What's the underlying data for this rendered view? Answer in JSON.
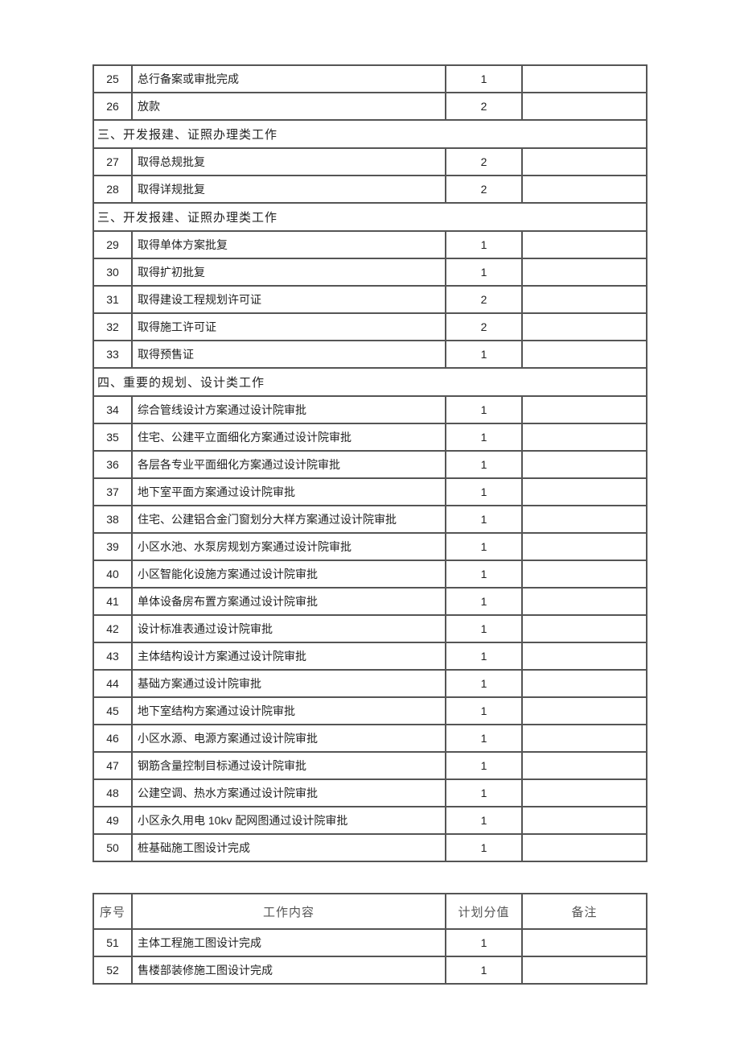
{
  "headers": {
    "idx": "序号",
    "desc": "工作内容",
    "val": "计划分值",
    "note": "备注"
  },
  "sections": [
    {
      "type": "rows",
      "rows": [
        {
          "idx": "25",
          "desc": "总行备案或审批完成",
          "val": "1",
          "note": ""
        },
        {
          "idx": "26",
          "desc": "放款",
          "val": "2",
          "note": ""
        }
      ]
    },
    {
      "type": "section",
      "title": "三、开发报建、证照办理类工作"
    },
    {
      "type": "rows",
      "rows": [
        {
          "idx": "27",
          "desc": "取得总规批复",
          "val": "2",
          "note": ""
        },
        {
          "idx": "28",
          "desc": "取得详规批复",
          "val": "2",
          "note": ""
        }
      ]
    },
    {
      "type": "section",
      "title": "三、开发报建、证照办理类工作"
    },
    {
      "type": "rows",
      "rows": [
        {
          "idx": "29",
          "desc": "取得单体方案批复",
          "val": "1",
          "note": ""
        },
        {
          "idx": "30",
          "desc": "取得扩初批复",
          "val": "1",
          "note": ""
        },
        {
          "idx": "31",
          "desc": "取得建设工程规划许可证",
          "val": "2",
          "note": ""
        },
        {
          "idx": "32",
          "desc": "取得施工许可证",
          "val": "2",
          "note": ""
        },
        {
          "idx": "33",
          "desc": "取得预售证",
          "val": "1",
          "note": ""
        }
      ]
    },
    {
      "type": "section",
      "title": "四、重要的规划、设计类工作"
    },
    {
      "type": "rows",
      "rows": [
        {
          "idx": "34",
          "desc": "综合管线设计方案通过设计院审批",
          "val": "1",
          "note": ""
        },
        {
          "idx": "35",
          "desc": "住宅、公建平立面细化方案通过设计院审批",
          "val": "1",
          "note": ""
        },
        {
          "idx": "36",
          "desc": "各层各专业平面细化方案通过设计院审批",
          "val": "1",
          "note": ""
        },
        {
          "idx": "37",
          "desc": "地下室平面方案通过设计院审批",
          "val": "1",
          "note": ""
        },
        {
          "idx": "38",
          "desc": "住宅、公建铝合金门窗划分大样方案通过设计院审批",
          "val": "1",
          "note": ""
        },
        {
          "idx": "39",
          "desc": "小区水池、水泵房规划方案通过设计院审批",
          "val": "1",
          "note": ""
        },
        {
          "idx": "40",
          "desc": "小区智能化设施方案通过设计院审批",
          "val": "1",
          "note": ""
        },
        {
          "idx": "41",
          "desc": "单体设备房布置方案通过设计院审批",
          "val": "1",
          "note": ""
        },
        {
          "idx": "42",
          "desc": "设计标准表通过设计院审批",
          "val": "1",
          "note": ""
        },
        {
          "idx": "43",
          "desc": "主体结构设计方案通过设计院审批",
          "val": "1",
          "note": ""
        },
        {
          "idx": "44",
          "desc": "基础方案通过设计院审批",
          "val": "1",
          "note": ""
        },
        {
          "idx": "45",
          "desc": "地下室结构方案通过设计院审批",
          "val": "1",
          "note": ""
        },
        {
          "idx": "46",
          "desc": "小区水源、电源方案通过设计院审批",
          "val": "1",
          "note": ""
        },
        {
          "idx": "47",
          "desc": "钢筋含量控制目标通过设计院审批",
          "val": "1",
          "note": ""
        },
        {
          "idx": "48",
          "desc": "公建空调、热水方案通过设计院审批",
          "val": "1",
          "note": ""
        },
        {
          "idx": "49",
          "desc": "小区永久用电  10kv  配网图通过设计院审批",
          "val": "1",
          "note": ""
        },
        {
          "idx": "50",
          "desc": "桩基础施工图设计完成",
          "val": "1",
          "note": ""
        }
      ]
    }
  ],
  "table2_rows": [
    {
      "idx": "51",
      "desc": "主体工程施工图设计完成",
      "val": "1",
      "note": ""
    },
    {
      "idx": "52",
      "desc": "售楼部装修施工图设计完成",
      "val": "1",
      "note": ""
    }
  ]
}
